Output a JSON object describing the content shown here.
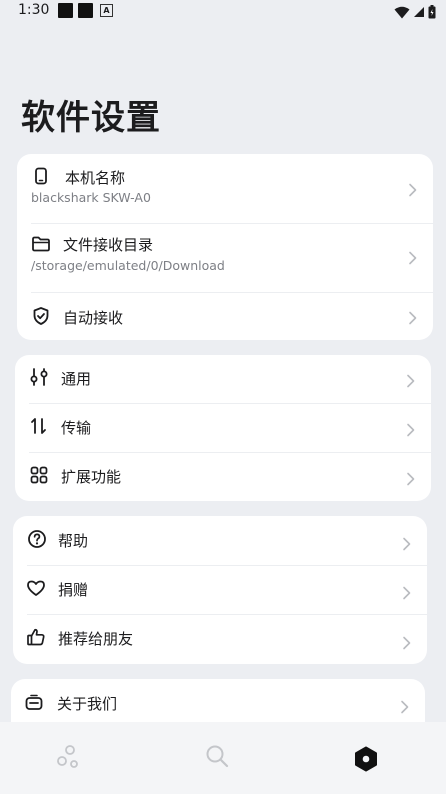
{
  "status_bar": {
    "time": "1:30",
    "notification_badge": "A"
  },
  "page": {
    "title": "软件设置"
  },
  "cards": [
    {
      "items": [
        {
          "icon": "phone-icon",
          "label": "本机名称",
          "subtitle": "blackshark SKW-A0"
        },
        {
          "icon": "folder-icon",
          "label": "文件接收目录",
          "subtitle": "/storage/emulated/0/Download"
        },
        {
          "icon": "shield-check-icon",
          "label": "自动接收"
        }
      ]
    },
    {
      "items": [
        {
          "icon": "sliders-icon",
          "label": "通用"
        },
        {
          "icon": "transfer-arrows-icon",
          "label": "传输"
        },
        {
          "icon": "grid-icon",
          "label": "扩展功能"
        }
      ]
    },
    {
      "items": [
        {
          "icon": "help-circle-icon",
          "label": "帮助"
        },
        {
          "icon": "heart-icon",
          "label": "捐赠"
        },
        {
          "icon": "thumbs-up-icon",
          "label": "推荐给朋友"
        }
      ]
    },
    {
      "items": [
        {
          "icon": "robot-icon",
          "label": "关于我们"
        }
      ]
    }
  ],
  "bottom_nav": {
    "items": [
      {
        "icon": "bubbles-icon",
        "active": false
      },
      {
        "icon": "search-icon",
        "active": false
      },
      {
        "icon": "hexagon-settings-icon",
        "active": true
      }
    ]
  },
  "colors": {
    "background": "#eceef2",
    "card": "#ffffff",
    "text_primary": "#1c1c1e",
    "text_secondary": "#7d7f85",
    "chevron": "#b9bbc0",
    "nav_inactive": "#c4c6ca",
    "nav_active": "#111111"
  }
}
